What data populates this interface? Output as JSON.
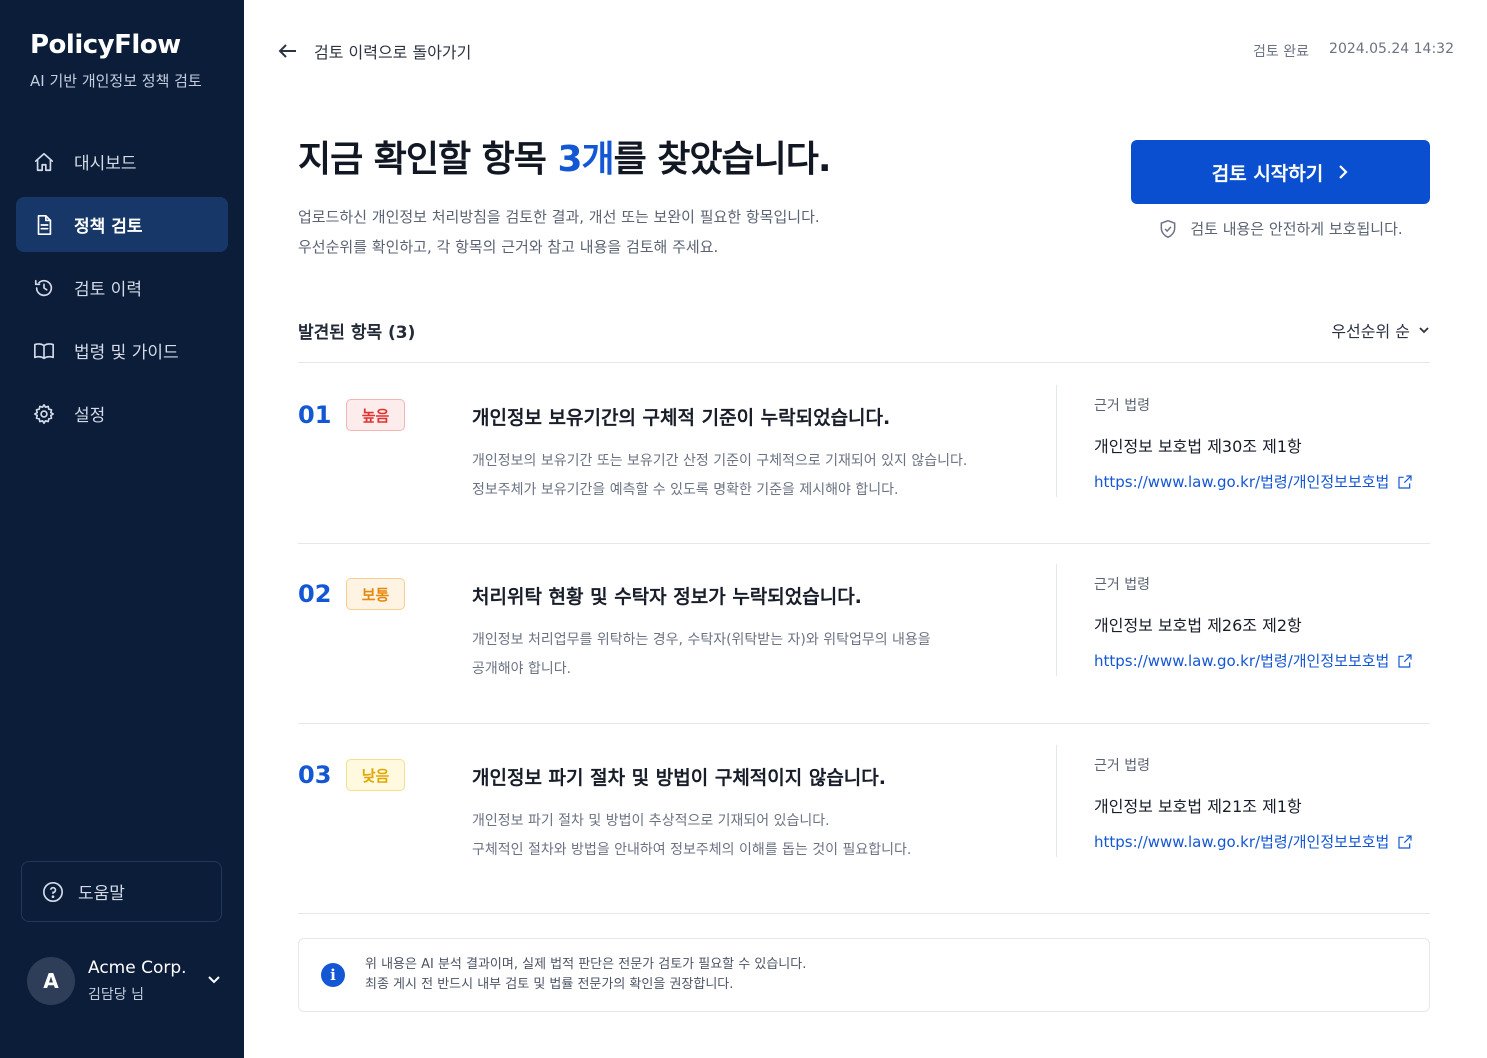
{
  "sidebar": {
    "brand": "PolicyFlow",
    "subtitle": "AI 기반 개인정보 정책 검토",
    "nav": [
      {
        "label": "대시보드",
        "icon": "home-icon"
      },
      {
        "label": "정책 검토",
        "icon": "document-icon",
        "active": true
      },
      {
        "label": "검토 이력",
        "icon": "history-icon"
      },
      {
        "label": "법령 및 가이드",
        "icon": "book-icon"
      },
      {
        "label": "설정",
        "icon": "gear-icon"
      }
    ],
    "help": "도움말",
    "account": {
      "avatar": "A",
      "name": "Acme Corp.",
      "role": "김담당 님"
    }
  },
  "topbar": {
    "back_label": "검토 이력으로 돌아가기",
    "status": "검토 완료",
    "datetime": "2024.05.24 14:32"
  },
  "hero": {
    "title_pre": "지금 확인할 항목 ",
    "title_highlight": "3개",
    "title_post": "를 찾았습니다.",
    "desc_line1": "업로드하신 개인정보 처리방침을 검토한 결과, 개선 또는 보완이 필요한 항목입니다.",
    "desc_line2": "우선순위를 확인하고, 각 항목의 근거와 참고 내용을 검토해 주세요.",
    "start_button": "검토 시작하기",
    "secure_note": "검토 내용은 안전하게 보호됩니다."
  },
  "list": {
    "title": "발견된 항목 (3)",
    "sort": "우선순위 순",
    "law_label": "근거 법령",
    "items": [
      {
        "num": "01",
        "priority": "높음",
        "title": "개인정보 보유기간의 구체적 기준이 누락되었습니다.",
        "desc1": "개인정보의 보유기간 또는 보유기간 산정 기준이 구체적으로 기재되어 있지 않습니다.",
        "desc2": "정보주체가 보유기간을 예측할 수 있도록 명확한 기준을 제시해야 합니다.",
        "law": "개인정보 보호법 제30조 제1항",
        "link": "https://www.law.go.kr/법령/개인정보보호법"
      },
      {
        "num": "02",
        "priority": "보통",
        "title": "처리위탁 현황 및 수탁자 정보가 누락되었습니다.",
        "desc1": "개인정보 처리업무를 위탁하는 경우, 수탁자(위탁받는 자)와 위탁업무의 내용을",
        "desc2": "공개해야 합니다.",
        "law": "개인정보 보호법 제26조 제2항",
        "link": "https://www.law.go.kr/법령/개인정보보호법"
      },
      {
        "num": "03",
        "priority": "낮음",
        "title": "개인정보 파기 절차 및 방법이 구체적이지 않습니다.",
        "desc1": "개인정보 파기 절차 및 방법이 추상적으로 기재되어 있습니다.",
        "desc2": "구체적인 절차와 방법을 안내하여 정보주체의 이해를 돕는 것이 필요합니다.",
        "law": "개인정보 보호법 제21조 제1항",
        "link": "https://www.law.go.kr/법령/개인정보보호법"
      }
    ]
  },
  "notice": {
    "line1": "위 내용은 AI 분석 결과이며, 실제 법적 판단은 전문가 검토가 필요할 수 있습니다.",
    "line2": "최종 게시 전 반드시 내부 검토 및 법률 전문가의 확인을 권장합니다."
  },
  "colors": {
    "sidebar_bg": "#0c1d3a",
    "accent": "#1457d4",
    "button": "#0b4fd1",
    "priority_high": "#e0342f",
    "priority_mid": "#e58a0e",
    "priority_low": "#e1a705"
  }
}
